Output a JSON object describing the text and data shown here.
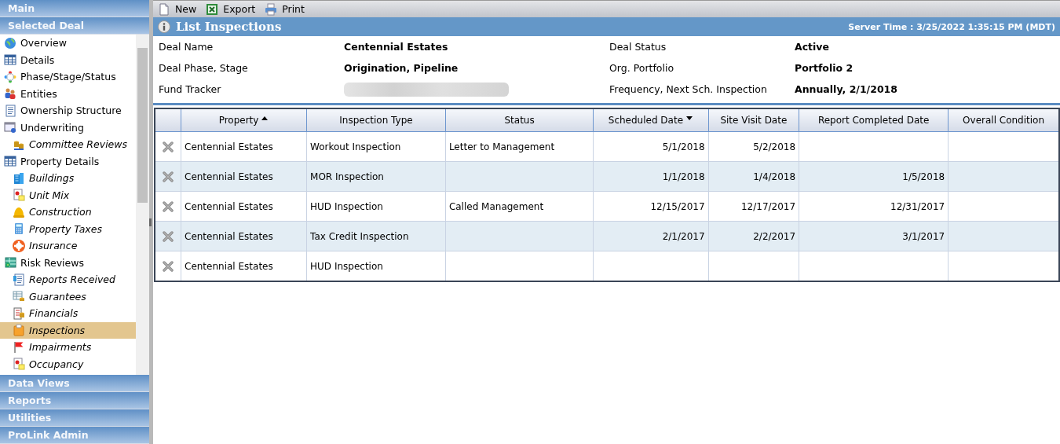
{
  "sidebar": {
    "top_sections": [
      {
        "label": "Main"
      },
      {
        "label": "Selected Deal"
      }
    ],
    "items": [
      {
        "label": "Overview",
        "selected": false
      },
      {
        "label": "Details",
        "selected": false
      },
      {
        "label": "Phase/Stage/Status",
        "selected": false
      },
      {
        "label": "Entities",
        "selected": false
      },
      {
        "label": "Ownership Structure",
        "selected": false
      },
      {
        "label": "Underwriting",
        "selected": false,
        "children": [
          {
            "label": "Committee Reviews",
            "selected": false
          }
        ]
      },
      {
        "label": "Property Details",
        "selected": false,
        "children": [
          {
            "label": "Buildings",
            "selected": false
          },
          {
            "label": "Unit Mix",
            "selected": false
          },
          {
            "label": "Construction",
            "selected": false
          },
          {
            "label": "Property Taxes",
            "selected": false
          },
          {
            "label": "Insurance",
            "selected": false
          }
        ]
      },
      {
        "label": "Risk Reviews",
        "selected": false,
        "children": [
          {
            "label": "Reports Received",
            "selected": false
          },
          {
            "label": "Guarantees",
            "selected": false
          },
          {
            "label": "Financials",
            "selected": false
          },
          {
            "label": "Inspections",
            "selected": true
          },
          {
            "label": "Impairments",
            "selected": false
          },
          {
            "label": "Occupancy",
            "selected": false
          }
        ]
      }
    ],
    "bottom_sections": [
      {
        "label": "Data Views"
      },
      {
        "label": "Reports"
      },
      {
        "label": "Utilities"
      },
      {
        "label": "ProLink Admin"
      }
    ]
  },
  "toolbar": [
    {
      "kind": "new",
      "label": "New"
    },
    {
      "kind": "export",
      "label": "Export"
    },
    {
      "kind": "print",
      "label": "Print"
    }
  ],
  "title_bar": {
    "title": "List Inspections",
    "server_time": "Server Time : 3/25/2022 1:35:15 PM (MDT)"
  },
  "deal_info": [
    {
      "label": "Deal Name",
      "value": "Centennial Estates"
    },
    {
      "label": "Deal Status",
      "value": "Active"
    },
    {
      "label": "Deal Phase, Stage",
      "value": "Origination, Pipeline"
    },
    {
      "label": "Org. Portfolio",
      "value": "Portfolio 2"
    },
    {
      "label": "Fund Tracker",
      "redacted": true
    },
    {
      "label": "Frequency, Next Sch. Inspection",
      "value": "Annually, 2/1/2018"
    }
  ],
  "table": {
    "columns": [
      {
        "label": "Property",
        "sorted_ascending": true,
        "sorted_descending": false,
        "right_aligned": false
      },
      {
        "label": "Inspection Type",
        "sorted_ascending": false,
        "sorted_descending": false,
        "right_aligned": false
      },
      {
        "label": "Status",
        "sorted_ascending": false,
        "sorted_descending": false,
        "right_aligned": false
      },
      {
        "label": "Scheduled Date",
        "sorted_ascending": false,
        "sorted_descending": true,
        "right_aligned": true
      },
      {
        "label": "Site Visit Date",
        "sorted_ascending": false,
        "sorted_descending": false,
        "right_aligned": true
      },
      {
        "label": "Report Completed Date",
        "sorted_ascending": false,
        "sorted_descending": false,
        "right_aligned": true
      },
      {
        "label": "Overall Condition",
        "sorted_ascending": false,
        "sorted_descending": false,
        "right_aligned": false
      }
    ],
    "rows": [
      {
        "cells": [
          "Centennial Estates",
          "Workout Inspection",
          "Letter to Management",
          "5/1/2018",
          "5/2/2018",
          "",
          ""
        ]
      },
      {
        "cells": [
          "Centennial Estates",
          "MOR Inspection",
          "",
          "1/1/2018",
          "1/4/2018",
          "1/5/2018",
          ""
        ]
      },
      {
        "cells": [
          "Centennial Estates",
          "HUD Inspection",
          "Called Management",
          "12/15/2017",
          "12/17/2017",
          "12/31/2017",
          ""
        ]
      },
      {
        "cells": [
          "Centennial Estates",
          "Tax Credit Inspection",
          "",
          "2/1/2017",
          "2/2/2017",
          "3/1/2017",
          ""
        ]
      },
      {
        "cells": [
          "Centennial Estates",
          "HUD Inspection",
          "",
          "",
          "",
          "",
          ""
        ]
      }
    ]
  }
}
